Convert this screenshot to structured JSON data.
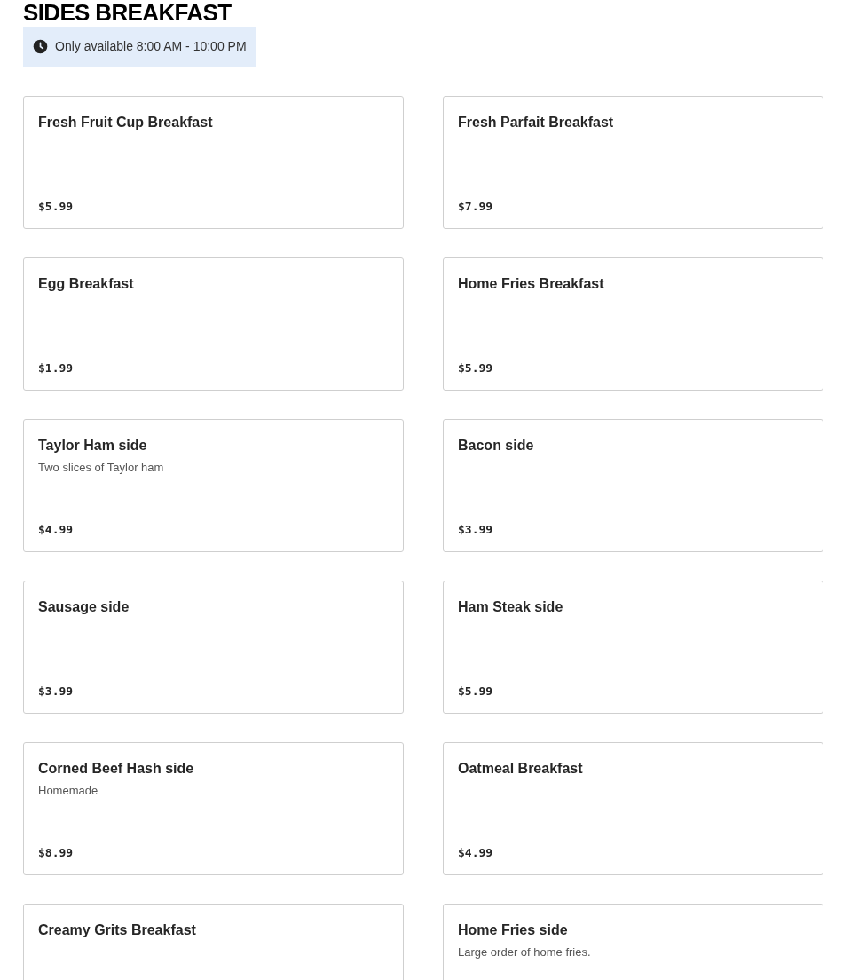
{
  "section": {
    "title": "SIDES BREAKFAST",
    "availability": "Only available 8:00 AM - 10:00 PM"
  },
  "items": [
    {
      "name": "Fresh Fruit Cup Breakfast",
      "price": "$5.99"
    },
    {
      "name": "Fresh Parfait Breakfast",
      "price": "$7.99"
    },
    {
      "name": "Egg Breakfast",
      "price": "$1.99"
    },
    {
      "name": "Home Fries Breakfast",
      "price": "$5.99"
    },
    {
      "name": "Taylor Ham side",
      "description": "Two slices of Taylor ham",
      "price": "$4.99"
    },
    {
      "name": "Bacon side",
      "price": "$3.99"
    },
    {
      "name": "Sausage side",
      "price": "$3.99"
    },
    {
      "name": "Ham Steak side",
      "price": "$5.99"
    },
    {
      "name": "Corned Beef Hash side",
      "description": "Homemade",
      "price": "$8.99"
    },
    {
      "name": "Oatmeal Breakfast",
      "price": "$4.99"
    },
    {
      "name": "Creamy Grits Breakfast"
    },
    {
      "name": "Home Fries side",
      "description": "Large order of home fries."
    }
  ]
}
